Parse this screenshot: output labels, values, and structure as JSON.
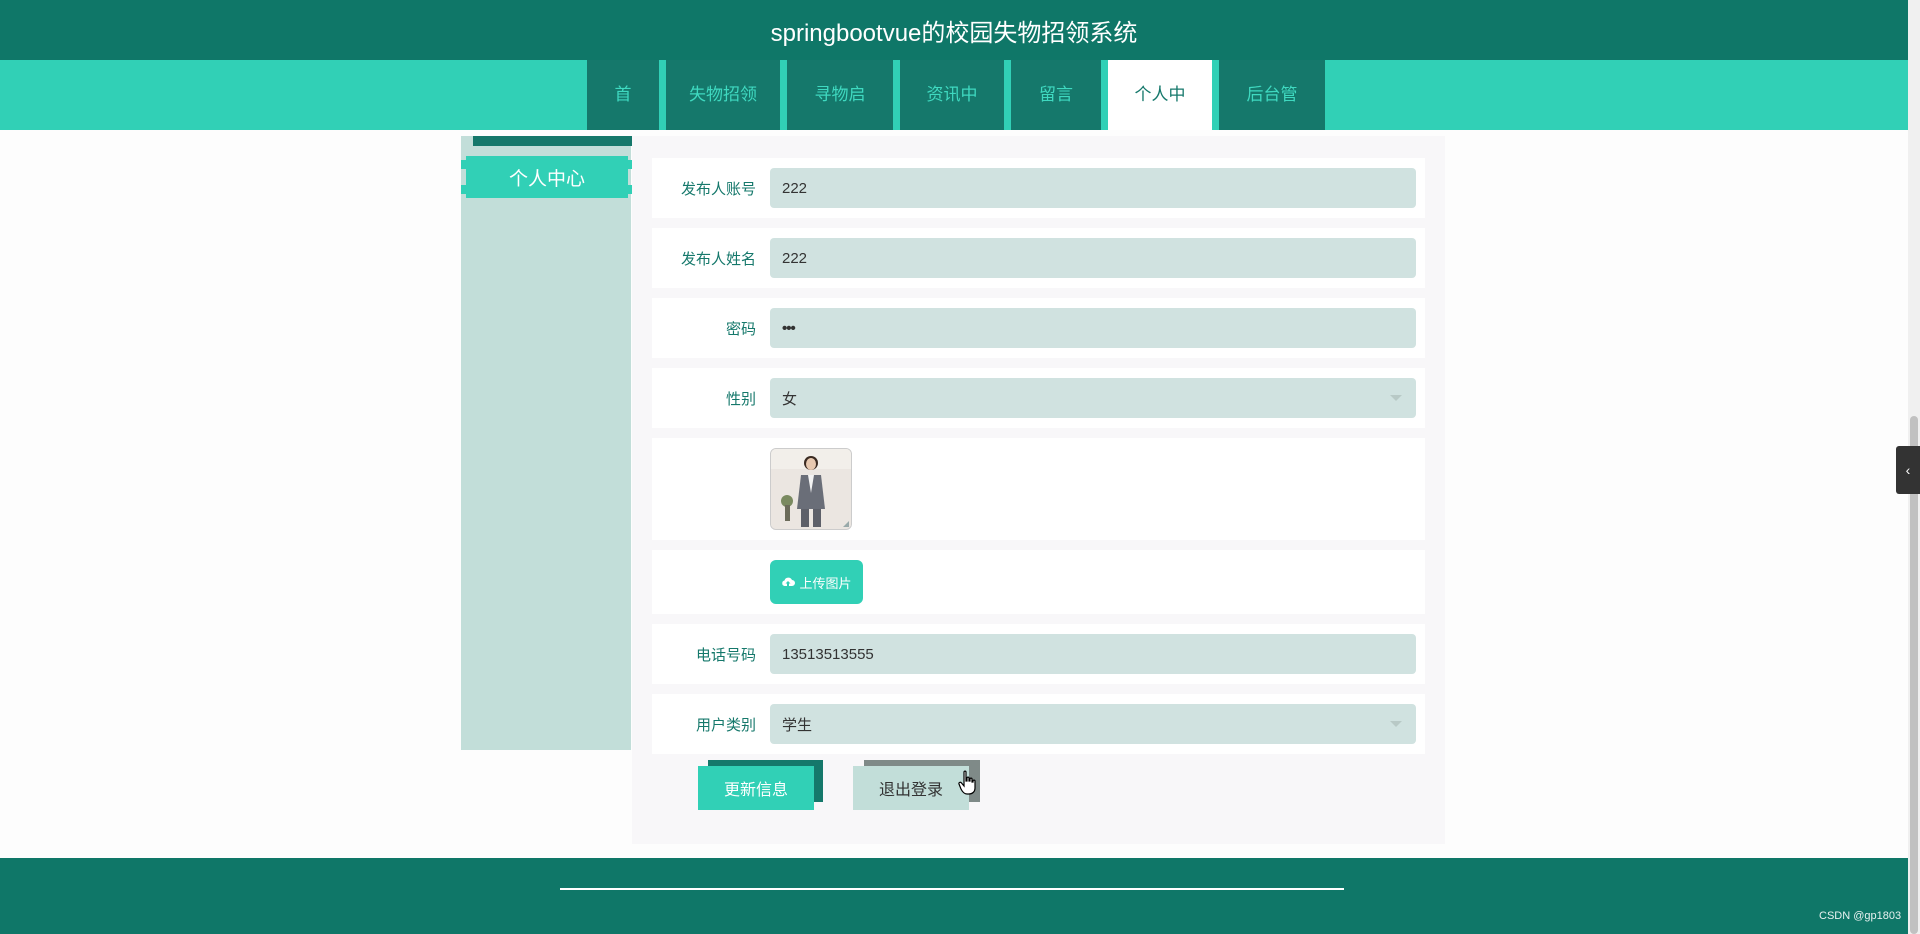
{
  "app": {
    "title": "springbootvue的校园失物招领系统"
  },
  "nav": {
    "items": [
      {
        "label": "首页",
        "active": false
      },
      {
        "label": "失物招领",
        "active": false
      },
      {
        "label": "寻物启事",
        "active": false
      },
      {
        "label": "资讯中心",
        "active": false
      },
      {
        "label": "留言板",
        "active": false
      },
      {
        "label": "个人中心",
        "active": true
      },
      {
        "label": "后台管理",
        "active": false
      }
    ]
  },
  "sidebar": {
    "tab_label": "个人中心"
  },
  "form": {
    "account": {
      "label": "发布人账号",
      "value": "222"
    },
    "name": {
      "label": "发布人姓名",
      "value": "222"
    },
    "password": {
      "label": "密码",
      "value": "•••"
    },
    "gender": {
      "label": "性别",
      "value": "女"
    },
    "upload_label": "上传图片",
    "phone": {
      "label": "电话号码",
      "value": "13513513555"
    },
    "user_type": {
      "label": "用户类别",
      "value": "学生"
    }
  },
  "buttons": {
    "update": "更新信息",
    "logout": "退出登录"
  },
  "footer": {
    "watermark": "CSDN @gp1803"
  },
  "colors": {
    "primary_dark": "#0f7768",
    "accent": "#31d0b6",
    "field_bg": "#d0e2e0",
    "sidebar_bg": "#c2ded9"
  },
  "icons": {
    "upload": "cloud-upload-icon",
    "collapse": "chevron-left-icon",
    "cursor": "hand-pointer-icon"
  }
}
